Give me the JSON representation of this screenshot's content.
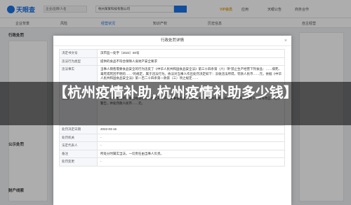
{
  "header": {
    "logo": "天眼查",
    "search_scope": "企业/品牌/人名",
    "search_value": "杭州某某科技有限公司",
    "nav": [
      "VIP会员",
      "应用",
      "天眼公告",
      "商务合作"
    ]
  },
  "tabs": [
    "企业背景",
    "风险",
    "经营状况",
    "知识产权",
    "历史信息",
    "自主经营"
  ],
  "active_tab": "经营状况",
  "sections": {
    "admin_penalty": "行政处罚",
    "tax_rating": "公示处罚",
    "finance": "财产线索"
  },
  "modal": {
    "title": "行政处罚详情",
    "close": "×",
    "rows": [
      {
        "key": "决定书文号",
        "value": "滨市监一处字〔2022〕50号"
      },
      {
        "key": "违法行为类型",
        "value": "提供的食品不符合保障人身财产安全要求"
      },
      {
        "key": "违法事实",
        "value": "当事人销售需要食品安全的行为违反了《中华人民共和国食品安全法》第三十四条第（六）项“禁止生产经营下列食品：……病死、毒死或死因不明的……”的规定，属于违法行为。依法对当事人作出处罚决定如下：没收违法所得，罚款人民币……元，依据《中华人民共和国食品安全法》第一百二十四条第一款第（三）项之规定……"
      },
      {
        "key": "处罚内容",
        "value": "明确，遂作出处罚。食品经营者违反规定未经许可从事食品生产经营活动，罚款并没收违法所得，处罚决定如下：责令改正，给予警告，并处罚款人民币……元。"
      },
      {
        "key": "处罚决定日期",
        "value": "2022-03-15"
      },
      {
        "key": "处罚机关",
        "value": "-"
      },
      {
        "key": "法定代表人",
        "value": "-"
      },
      {
        "key": "备注",
        "value": "所处分时属实当法，一切责任由当事人负责。"
      },
      {
        "key": "处罚变更",
        "value": "-"
      }
    ]
  },
  "banner": "【杭州疫情补助,杭州疫情补助多少钱】"
}
